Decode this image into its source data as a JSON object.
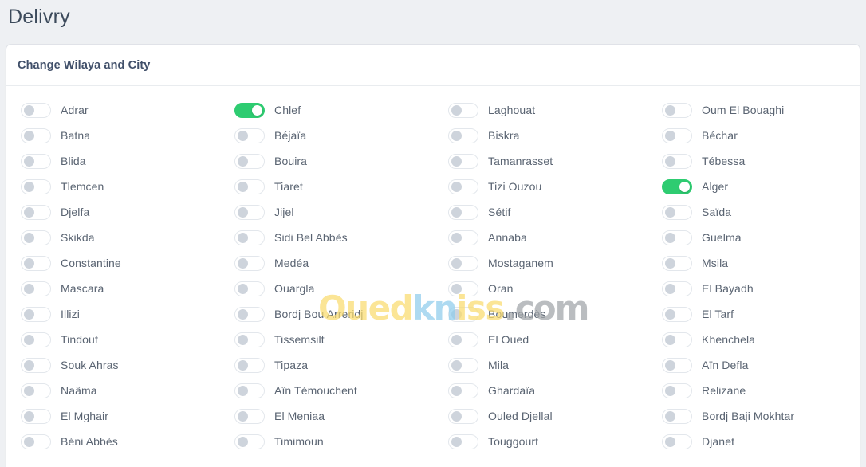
{
  "page": {
    "title": "Delivry",
    "background_color": "#eef0f3"
  },
  "card": {
    "header_title": "Change Wilaya and City",
    "background_color": "#ffffff"
  },
  "theme": {
    "toggle_on_color": "#2ecc71",
    "toggle_off_knob_color": "#ced4dc",
    "toggle_off_track_color": "#ffffff",
    "label_color": "#5a6472",
    "title_color": "#3c4a5b"
  },
  "watermark": {
    "part1": "Oued",
    "part2": "kn",
    "part3": "iss",
    "part4": ".com",
    "part1_color": "#fadc6e",
    "part2_color": "#8fcdec",
    "part3_color": "#fadc6e",
    "part4_color": "#a0a4a8"
  },
  "wilayas": [
    {
      "label": "Adrar",
      "enabled": false,
      "column": 1,
      "row": 1
    },
    {
      "label": "Batna",
      "enabled": false,
      "column": 1,
      "row": 2
    },
    {
      "label": "Blida",
      "enabled": false,
      "column": 1,
      "row": 3
    },
    {
      "label": "Tlemcen",
      "enabled": false,
      "column": 1,
      "row": 4
    },
    {
      "label": "Djelfa",
      "enabled": false,
      "column": 1,
      "row": 5
    },
    {
      "label": "Skikda",
      "enabled": false,
      "column": 1,
      "row": 6
    },
    {
      "label": "Constantine",
      "enabled": false,
      "column": 1,
      "row": 7
    },
    {
      "label": "Mascara",
      "enabled": false,
      "column": 1,
      "row": 8
    },
    {
      "label": "Illizi",
      "enabled": false,
      "column": 1,
      "row": 9
    },
    {
      "label": "Tindouf",
      "enabled": false,
      "column": 1,
      "row": 10
    },
    {
      "label": "Souk Ahras",
      "enabled": false,
      "column": 1,
      "row": 11
    },
    {
      "label": "Naâma",
      "enabled": false,
      "column": 1,
      "row": 12
    },
    {
      "label": "El Mghair",
      "enabled": false,
      "column": 1,
      "row": 13
    },
    {
      "label": "Béni Abbès",
      "enabled": false,
      "column": 1,
      "row": 14
    },
    {
      "label": "Chlef",
      "enabled": true,
      "column": 2,
      "row": 1
    },
    {
      "label": "Béjaïa",
      "enabled": false,
      "column": 2,
      "row": 2
    },
    {
      "label": "Bouira",
      "enabled": false,
      "column": 2,
      "row": 3
    },
    {
      "label": "Tiaret",
      "enabled": false,
      "column": 2,
      "row": 4
    },
    {
      "label": "Jijel",
      "enabled": false,
      "column": 2,
      "row": 5
    },
    {
      "label": "Sidi Bel Abbès",
      "enabled": false,
      "column": 2,
      "row": 6
    },
    {
      "label": "Medéa",
      "enabled": false,
      "column": 2,
      "row": 7
    },
    {
      "label": "Ouargla",
      "enabled": false,
      "column": 2,
      "row": 8
    },
    {
      "label": "Bordj Bou Arreridj",
      "enabled": false,
      "column": 2,
      "row": 9
    },
    {
      "label": "Tissemsilt",
      "enabled": false,
      "column": 2,
      "row": 10
    },
    {
      "label": "Tipaza",
      "enabled": false,
      "column": 2,
      "row": 11
    },
    {
      "label": "Aïn Témouchent",
      "enabled": false,
      "column": 2,
      "row": 12
    },
    {
      "label": "El Meniaa",
      "enabled": false,
      "column": 2,
      "row": 13
    },
    {
      "label": "Timimoun",
      "enabled": false,
      "column": 2,
      "row": 14
    },
    {
      "label": "Laghouat",
      "enabled": false,
      "column": 3,
      "row": 1
    },
    {
      "label": "Biskra",
      "enabled": false,
      "column": 3,
      "row": 2
    },
    {
      "label": "Tamanrasset",
      "enabled": false,
      "column": 3,
      "row": 3
    },
    {
      "label": "Tizi Ouzou",
      "enabled": false,
      "column": 3,
      "row": 4
    },
    {
      "label": "Sétif",
      "enabled": false,
      "column": 3,
      "row": 5
    },
    {
      "label": "Annaba",
      "enabled": false,
      "column": 3,
      "row": 6
    },
    {
      "label": "Mostaganem",
      "enabled": false,
      "column": 3,
      "row": 7
    },
    {
      "label": "Oran",
      "enabled": false,
      "column": 3,
      "row": 8
    },
    {
      "label": "Boumerdès",
      "enabled": false,
      "column": 3,
      "row": 9
    },
    {
      "label": "El Oued",
      "enabled": false,
      "column": 3,
      "row": 10
    },
    {
      "label": "Mila",
      "enabled": false,
      "column": 3,
      "row": 11
    },
    {
      "label": "Ghardaïa",
      "enabled": false,
      "column": 3,
      "row": 12
    },
    {
      "label": "Ouled Djellal",
      "enabled": false,
      "column": 3,
      "row": 13
    },
    {
      "label": "Touggourt",
      "enabled": false,
      "column": 3,
      "row": 14
    },
    {
      "label": "Oum El Bouaghi",
      "enabled": false,
      "column": 4,
      "row": 1
    },
    {
      "label": "Béchar",
      "enabled": false,
      "column": 4,
      "row": 2
    },
    {
      "label": "Tébessa",
      "enabled": false,
      "column": 4,
      "row": 3
    },
    {
      "label": "Alger",
      "enabled": true,
      "column": 4,
      "row": 4
    },
    {
      "label": "Saïda",
      "enabled": false,
      "column": 4,
      "row": 5
    },
    {
      "label": "Guelma",
      "enabled": false,
      "column": 4,
      "row": 6
    },
    {
      "label": "Msila",
      "enabled": false,
      "column": 4,
      "row": 7
    },
    {
      "label": "El Bayadh",
      "enabled": false,
      "column": 4,
      "row": 8
    },
    {
      "label": "El Tarf",
      "enabled": false,
      "column": 4,
      "row": 9
    },
    {
      "label": "Khenchela",
      "enabled": false,
      "column": 4,
      "row": 10
    },
    {
      "label": "Aïn Defla",
      "enabled": false,
      "column": 4,
      "row": 11
    },
    {
      "label": "Relizane",
      "enabled": false,
      "column": 4,
      "row": 12
    },
    {
      "label": "Bordj Baji Mokhtar",
      "enabled": false,
      "column": 4,
      "row": 13
    },
    {
      "label": "Djanet",
      "enabled": false,
      "column": 4,
      "row": 14
    }
  ]
}
